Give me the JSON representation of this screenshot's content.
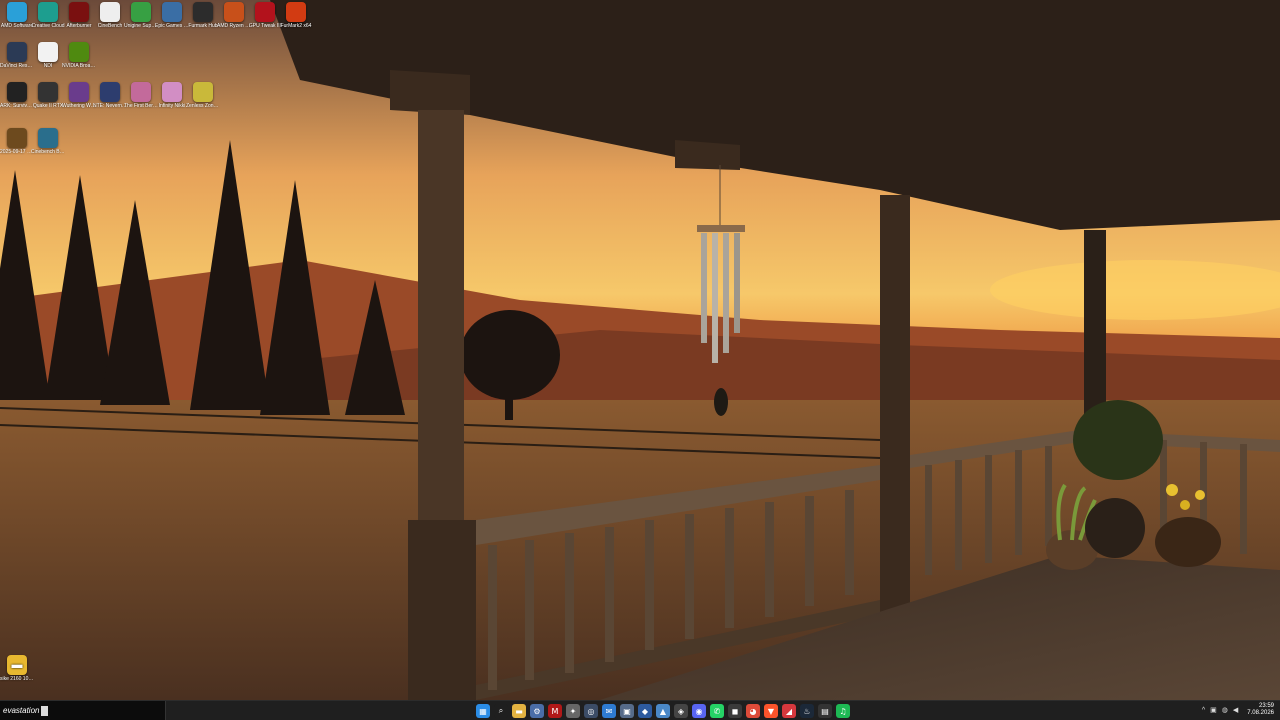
{
  "desktop": {
    "icons": [
      {
        "label": "AMD Software",
        "icon": "amd-software-icon",
        "color": "#2aa0d8"
      },
      {
        "label": "Creative Cloud",
        "icon": "creative-cloud-icon",
        "color": "#1d9e8f"
      },
      {
        "label": "Afterburner",
        "icon": "msi-afterburner-icon",
        "color": "#7a1010"
      },
      {
        "label": "CineBench",
        "icon": "cinebench-icon",
        "color": "#eeeeee"
      },
      {
        "label": "Unigine Superposition",
        "icon": "superposition-icon",
        "color": "#37a043"
      },
      {
        "label": "Epic Games Launcher",
        "icon": "epic-games-icon",
        "color": "#3a6ea5"
      },
      {
        "label": "Furmark Hub",
        "icon": "furmark-hub-icon",
        "color": "#2c2c2c"
      },
      {
        "label": "AMD Ryzen Master",
        "icon": "ryzen-master-icon",
        "color": "#c8501a"
      },
      {
        "label": "GPU Tweak III",
        "icon": "gpu-tweak-icon",
        "color": "#b3121c"
      },
      {
        "label": "FurMark2 x64",
        "icon": "furmark2-icon",
        "color": "#d23b12"
      },
      {
        "label": "DaVinci Resolve",
        "icon": "davinci-resolve-icon",
        "color": "#2b3a55"
      },
      {
        "label": "NDI",
        "icon": "ndi-icon",
        "color": "#f2f2f2"
      },
      {
        "label": "NVIDIA Broadcast",
        "icon": "nvidia-broadcast-icon",
        "color": "#4f8a10"
      },
      {
        "label": "ARK: Survival Evolved",
        "icon": "ark-icon",
        "color": "#222222"
      },
      {
        "label": "Quake II RTX",
        "icon": "quake-icon",
        "color": "#333333"
      },
      {
        "label": "Wuthering Waves",
        "icon": "wuthering-waves-icon",
        "color": "#6a3c8c"
      },
      {
        "label": "NTE: Neverness To Everness",
        "icon": "nte-icon",
        "color": "#2d3d6e"
      },
      {
        "label": "The First Berserker",
        "icon": "first-berserker-icon",
        "color": "#c36a9b"
      },
      {
        "label": "Infinity Nikki",
        "icon": "infinity-nikki-icon",
        "color": "#d28ec4"
      },
      {
        "label": "Zenless Zone Zero",
        "icon": "zzz-icon",
        "color": "#c9b93a"
      },
      {
        "label": "2025-09-17 19h06m",
        "icon": "video-file-icon",
        "color": "#6d4a1e"
      },
      {
        "label": "Cinebench Benchmark",
        "icon": "benchmark-icon",
        "color": "#2a6e8c"
      }
    ],
    "folder": {
      "label": "sike 2160 1080 1...",
      "icon": "folder-icon"
    }
  },
  "taskbar": {
    "search_text": "evastation",
    "apps": [
      {
        "name": "start-icon",
        "color": "#2b8de6",
        "glyph": "▦"
      },
      {
        "name": "search-icon",
        "color": "#1f1f1f",
        "glyph": "⌕"
      },
      {
        "name": "file-explorer-icon",
        "color": "#e3b341",
        "glyph": "▬"
      },
      {
        "name": "settings-icon",
        "color": "#4a6ea8",
        "glyph": "⚙"
      },
      {
        "name": "msi-icon",
        "color": "#b01818",
        "glyph": "M"
      },
      {
        "name": "app-icon-1",
        "color": "#666666",
        "glyph": "✦"
      },
      {
        "name": "app-icon-2",
        "color": "#3b4c66",
        "glyph": "◎"
      },
      {
        "name": "mail-icon",
        "color": "#2e7bd1",
        "glyph": "✉"
      },
      {
        "name": "app-icon-3",
        "color": "#566b8a",
        "glyph": "▣"
      },
      {
        "name": "app-icon-4",
        "color": "#2d5a9e",
        "glyph": "◆"
      },
      {
        "name": "photos-icon",
        "color": "#4a88c7",
        "glyph": "▲"
      },
      {
        "name": "app-icon-5",
        "color": "#444444",
        "glyph": "◈"
      },
      {
        "name": "discord-icon",
        "color": "#5865f2",
        "glyph": "◉"
      },
      {
        "name": "whatsapp-icon",
        "color": "#25d366",
        "glyph": "✆"
      },
      {
        "name": "app-icon-6",
        "color": "#3a3a3a",
        "glyph": "◼"
      },
      {
        "name": "chrome-icon",
        "color": "#dd4b39",
        "glyph": "◕"
      },
      {
        "name": "brave-icon",
        "color": "#fb542b",
        "glyph": "▼"
      },
      {
        "name": "app-icon-7",
        "color": "#d6383d",
        "glyph": "◢"
      },
      {
        "name": "steam-icon",
        "color": "#1b2838",
        "glyph": "♨"
      },
      {
        "name": "app-icon-8",
        "color": "#333333",
        "glyph": "▤"
      },
      {
        "name": "spotify-icon",
        "color": "#1db954",
        "glyph": "♫"
      }
    ],
    "tray": {
      "chevron": "^",
      "time": "23:59",
      "date": "7.08.2026"
    }
  }
}
